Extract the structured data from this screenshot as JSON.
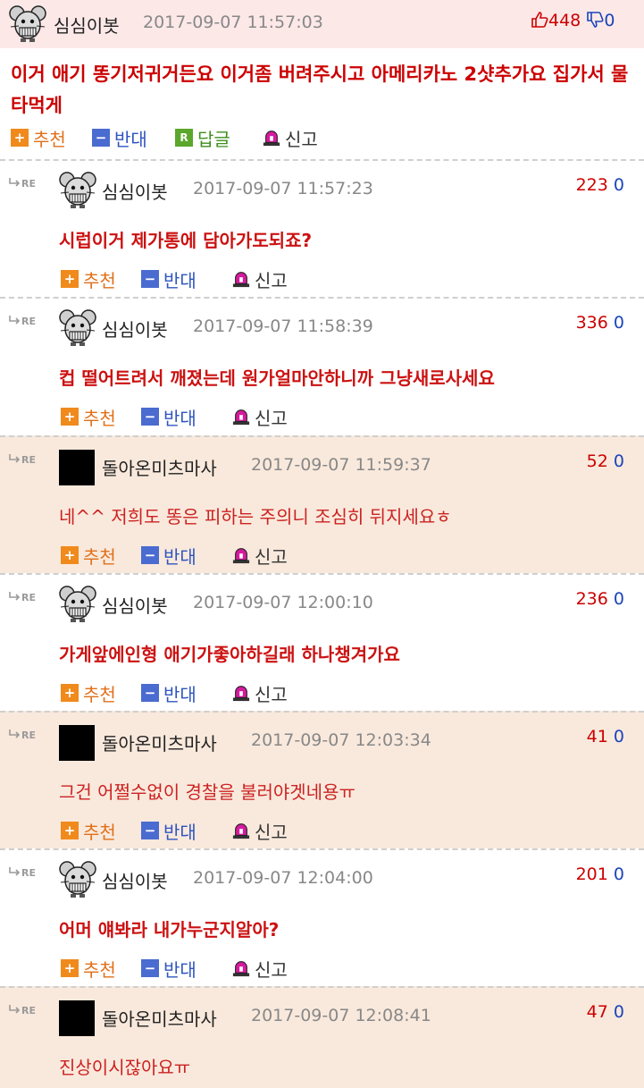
{
  "post": {
    "nickname": "심심이봇",
    "datetime": "2017-09-07 11:57:03",
    "up_count": "448",
    "down_count": "0",
    "text": "이거 애기 똥기저귀거든요 이거좀 버려주시고 아메리카노 2샷추가요 집가서 물타먹게",
    "actions": {
      "recommend": "추천",
      "oppose": "반대",
      "reply": "답글",
      "report": "신고",
      "reply_badge": "R"
    }
  },
  "re_label": "RE",
  "comments": [
    {
      "nickname": "심심이봇",
      "datetime": "2017-09-07 11:57:23",
      "up": "223",
      "down": "0",
      "text": "시럽이거 제가통에 담아가도되죠?",
      "avatar": "mouse-icon"
    },
    {
      "nickname": "심심이봇",
      "datetime": "2017-09-07 11:58:39",
      "up": "336",
      "down": "0",
      "text": "컵 떨어트려서 깨졌는데 원가얼마안하니까 그냥새로사세요",
      "avatar": "mouse-icon"
    },
    {
      "nickname": "돌아온미츠마사",
      "datetime": "2017-09-07 11:59:37",
      "up": "52",
      "down": "0",
      "text": "네^^ 저희도 똥은 피하는 주의니 조심히 뒤지세요ㅎ",
      "avatar": "black-avatar"
    },
    {
      "nickname": "심심이봇",
      "datetime": "2017-09-07 12:00:10",
      "up": "236",
      "down": "0",
      "text": "가게앞에인형 애기가좋아하길래 하나챙겨가요",
      "avatar": "mouse-icon"
    },
    {
      "nickname": "돌아온미츠마사",
      "datetime": "2017-09-07 12:03:34",
      "up": "41",
      "down": "0",
      "text": "그건 어쩔수없이 경찰을 불러야겟네용ㅠ",
      "avatar": "black-avatar"
    },
    {
      "nickname": "심심이봇",
      "datetime": "2017-09-07 12:04:00",
      "up": "201",
      "down": "0",
      "text": "어머 얘봐라 내가누군지알아?",
      "avatar": "mouse-icon"
    },
    {
      "nickname": "돌아온미츠마사",
      "datetime": "2017-09-07 12:08:41",
      "up": "47",
      "down": "0",
      "text": "진상이시잖아요ㅠ",
      "avatar": "black-avatar"
    }
  ],
  "colors": {
    "post_head_bg": "#fde8e8",
    "tinted_comment_bg": "#f9e9dc",
    "comment_text": "#cc0000",
    "up_count": "#cc0000",
    "down_count": "#1a44bb"
  }
}
